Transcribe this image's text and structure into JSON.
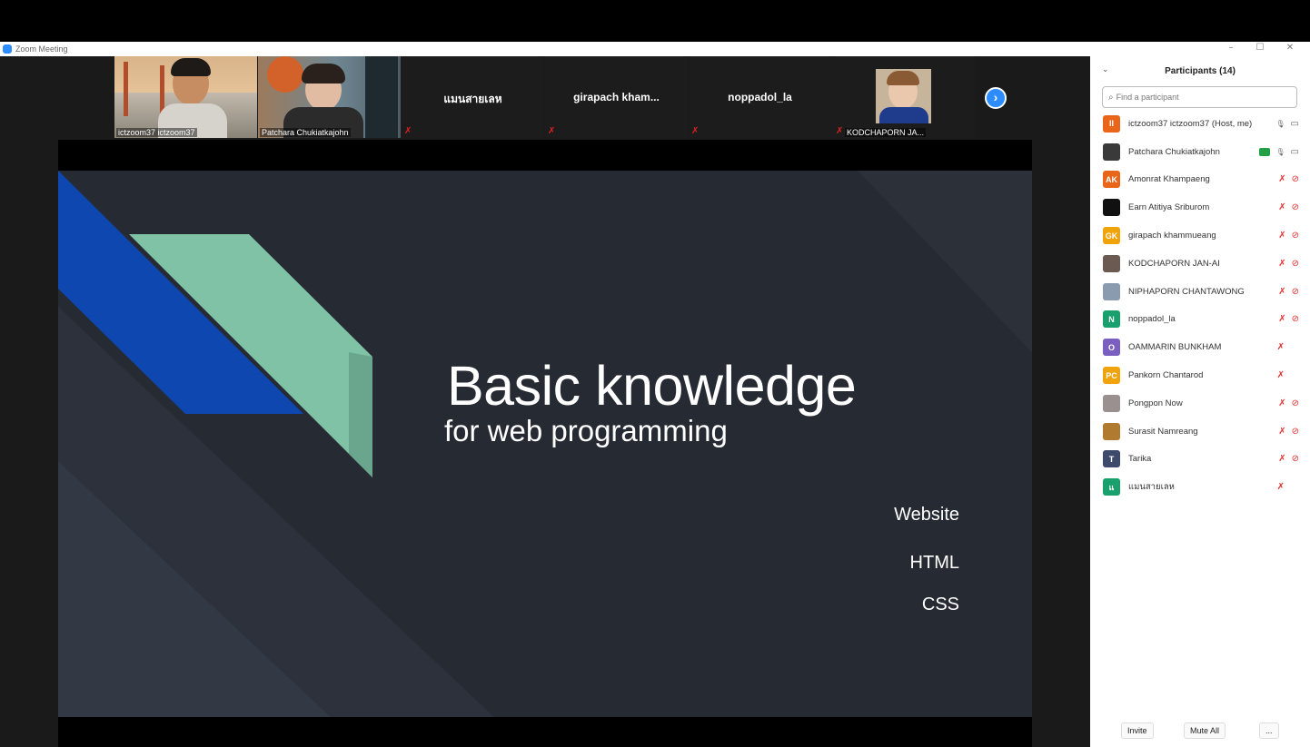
{
  "window": {
    "title": "Zoom Meeting",
    "minimize": "–",
    "maximize": "☐",
    "close": "✕"
  },
  "thumbnails": [
    {
      "label": "ictzoom37 ictzoom37",
      "has_video": true,
      "active": false
    },
    {
      "label": "Patchara Chukiatkajohn",
      "has_video": true,
      "active": true
    },
    {
      "label": "แมนสายเลห",
      "has_video": false
    },
    {
      "label": "girapach  kham...",
      "has_video": false
    },
    {
      "label": "noppadol_la",
      "has_video": false
    },
    {
      "label": "KODCHAPORN JA...",
      "has_video": true
    }
  ],
  "slide": {
    "title": "Basic knowledge",
    "subtitle": "for web programming",
    "items": [
      "Website",
      "HTML",
      "CSS"
    ]
  },
  "panel": {
    "header": "Participants (14)",
    "search_placeholder": "Find a participant",
    "participants": [
      {
        "name": "ictzoom37 ictzoom37 (Host, me)",
        "initials": "II",
        "color": "#E8651A",
        "mic": "on",
        "cam": "on"
      },
      {
        "name": "Patchara Chukiatkajohn",
        "initials": "",
        "color": "#3a3a3a",
        "mic": "on",
        "cam": "on",
        "sharing": true
      },
      {
        "name": "Amonrat Khampaeng",
        "initials": "AK",
        "color": "#E8651A",
        "mic": "off",
        "cam": "off"
      },
      {
        "name": "Earn Atitiya Sriburom",
        "initials": "",
        "color": "#111111",
        "mic": "off",
        "cam": "off"
      },
      {
        "name": "girapach khammueang",
        "initials": "GK",
        "color": "#F0A30A",
        "mic": "off",
        "cam": "off"
      },
      {
        "name": "KODCHAPORN JAN-AI",
        "initials": "",
        "color": "#6b5a52",
        "mic": "off",
        "cam": "off"
      },
      {
        "name": "NIPHAPORN CHANTAWONG",
        "initials": "",
        "color": "#8a9bb0",
        "mic": "off",
        "cam": "off"
      },
      {
        "name": "noppadol_la",
        "initials": "N",
        "color": "#1AA06D",
        "mic": "off",
        "cam": "off"
      },
      {
        "name": "OAMMARIN BUNKHAM",
        "initials": "O",
        "color": "#7B5FC0",
        "mic": "off",
        "cam": "none"
      },
      {
        "name": "Pankorn Chantarod",
        "initials": "PC",
        "color": "#F0A30A",
        "mic": "off",
        "cam": "none"
      },
      {
        "name": "Pongpon Now",
        "initials": "",
        "color": "#9a9090",
        "mic": "off",
        "cam": "off"
      },
      {
        "name": "Surasit Namreang",
        "initials": "",
        "color": "#b07a30",
        "mic": "off",
        "cam": "off"
      },
      {
        "name": "Tarika",
        "initials": "T",
        "color": "#3E4A6B",
        "mic": "off",
        "cam": "off"
      },
      {
        "name": "แมนสายเลห",
        "initials": "แ",
        "color": "#1AA06D",
        "mic": "off",
        "cam": "none"
      }
    ],
    "footer": {
      "invite": "Invite",
      "mute_all": "Mute All",
      "more": "..."
    }
  },
  "icons": {
    "mic_on": "🎙",
    "mic_off": "✗",
    "cam_on": "▭",
    "cam_off": "⊘",
    "next": "›",
    "chevron": "⌄",
    "search": "⌕"
  },
  "colors": {
    "zoom_blue": "#2D8CFF",
    "slide_bg": "#262a33",
    "slide_accent_blue": "#0f47b0",
    "slide_accent_teal": "#7fc2a6",
    "muted_red": "#e03030"
  }
}
